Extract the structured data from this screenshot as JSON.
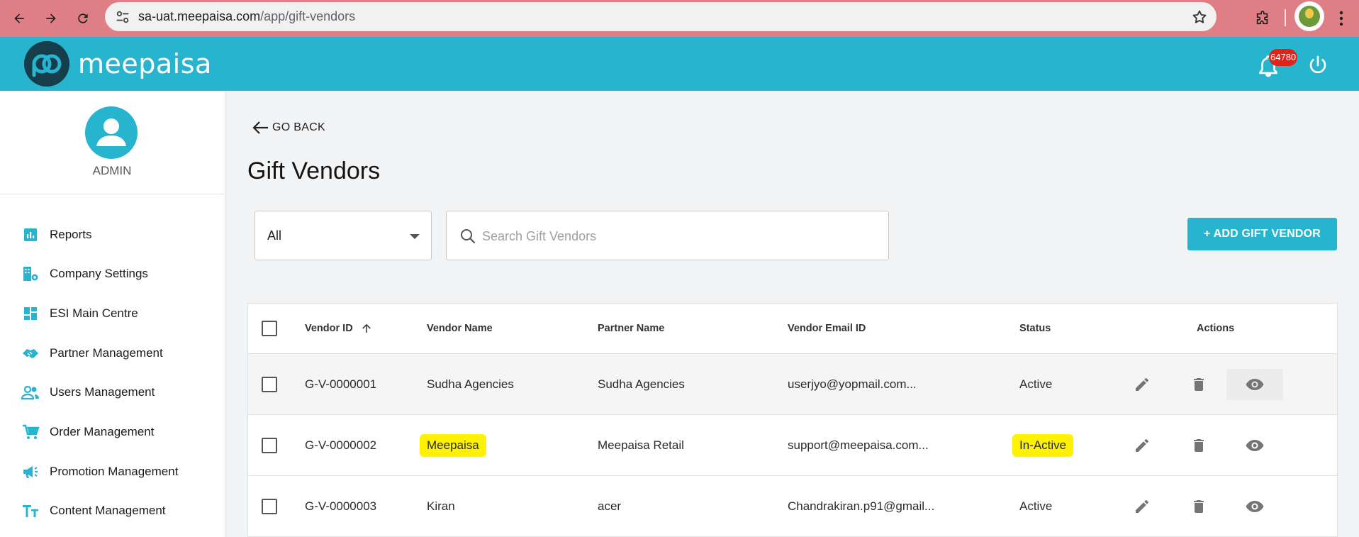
{
  "browser": {
    "url_host": "sa-uat.meepaisa.com",
    "url_path": "/app/gift-vendors"
  },
  "header": {
    "brand": "meepaisa",
    "notification_count": "64780"
  },
  "sidebar": {
    "user_label": "ADMIN",
    "items": [
      {
        "label": "Reports",
        "icon": "bar-chart-icon"
      },
      {
        "label": "Company Settings",
        "icon": "building-settings-icon"
      },
      {
        "label": "ESI Main Centre",
        "icon": "dashboard-grid-icon"
      },
      {
        "label": "Partner Management",
        "icon": "handshake-icon"
      },
      {
        "label": "Users Management",
        "icon": "users-icon"
      },
      {
        "label": "Order Management",
        "icon": "cart-icon"
      },
      {
        "label": "Promotion Management",
        "icon": "megaphone-icon"
      },
      {
        "label": "Content Management",
        "icon": "text-format-icon"
      }
    ]
  },
  "main": {
    "go_back": "GO BACK",
    "title": "Gift Vendors",
    "filter": {
      "selected": "All"
    },
    "search": {
      "placeholder": "Search Gift Vendors",
      "value": ""
    },
    "add_button": "+ ADD GIFT VENDOR"
  },
  "table": {
    "columns": [
      "Vendor ID",
      "Vendor Name",
      "Partner Name",
      "Vendor Email ID",
      "Status",
      "Actions"
    ],
    "sort_column": "Vendor ID",
    "sort_direction": "ascending",
    "rows": [
      {
        "vendor_id": "G-V-0000001",
        "vendor_name": "Sudha Agencies",
        "partner_name": "Sudha Agencies",
        "email": "userjyo@yopmail.com...",
        "status": "Active",
        "highlight": false
      },
      {
        "vendor_id": "G-V-0000002",
        "vendor_name": "Meepaisa",
        "partner_name": "Meepaisa Retail",
        "email": "support@meepaisa.com...",
        "status": "In-Active",
        "highlight": true
      },
      {
        "vendor_id": "G-V-0000003",
        "vendor_name": "Kiran",
        "partner_name": "acer",
        "email": "Chandrakiran.p91@gmail...",
        "status": "Active",
        "highlight": false
      }
    ]
  },
  "colors": {
    "brand": "#27b4cf",
    "chrome_bar": "#e07e86",
    "highlight": "#fff200",
    "badge": "#e2231a"
  }
}
